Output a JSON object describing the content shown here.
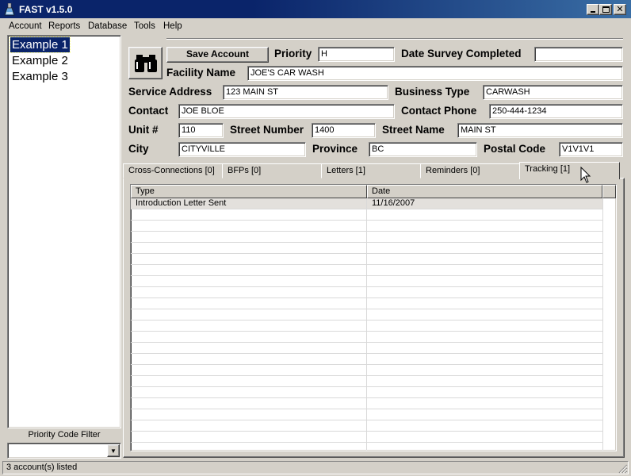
{
  "window": {
    "title": "FAST v1.5.0"
  },
  "menu": [
    "Account",
    "Reports",
    "Database",
    "Tools",
    "Help"
  ],
  "accounts": [
    "Example 1",
    "Example 2",
    "Example 3"
  ],
  "filter": {
    "label": "Priority Code Filter",
    "value": ""
  },
  "status": "3 account(s) listed",
  "toolbar": {
    "save_label": "Save Account"
  },
  "form": {
    "priority_label": "Priority",
    "priority": "H",
    "date_survey_label": "Date Survey Completed",
    "date_survey": "",
    "facility_label": "Facility Name",
    "facility": "JOE'S CAR WASH",
    "service_address_label": "Service Address",
    "service_address": "123 MAIN ST",
    "business_type_label": "Business Type",
    "business_type": "CARWASH",
    "contact_label": "Contact",
    "contact": "JOE BLOE",
    "contact_phone_label": "Contact Phone",
    "contact_phone": "250-444-1234",
    "unit_label": "Unit #",
    "unit": "110",
    "street_number_label": "Street Number",
    "street_number": "1400",
    "street_name_label": "Street Name",
    "street_name": "MAIN ST",
    "city_label": "City",
    "city": "CITYVILLE",
    "province_label": "Province",
    "province": "BC",
    "postal_code_label": "Postal Code",
    "postal_code": "V1V1V1"
  },
  "tabs": [
    {
      "label": "Cross-Connections  [0]"
    },
    {
      "label": "BFPs  [0]"
    },
    {
      "label": "Letters  [1]"
    },
    {
      "label": "Reminders  [0]"
    },
    {
      "label": "Tracking  [1]",
      "active": true
    }
  ],
  "grid": {
    "columns": [
      "Type",
      "Date"
    ],
    "rows": [
      {
        "type": "Introduction Letter Sent",
        "date": "11/16/2007"
      }
    ]
  }
}
